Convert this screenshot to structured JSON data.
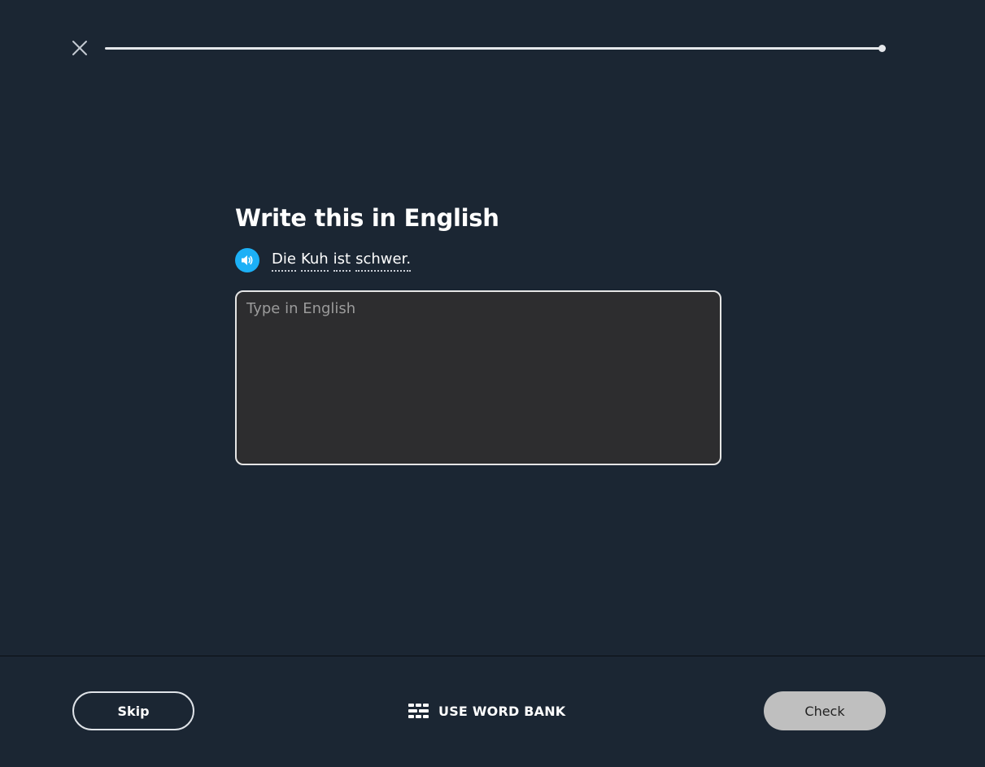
{
  "header": {
    "progress": 1.0
  },
  "challenge": {
    "title": "Write this in English",
    "prompt_words": [
      "Die",
      "Kuh",
      "ist",
      "schwer."
    ],
    "answer_placeholder": "Type in English",
    "answer_value": ""
  },
  "footer": {
    "skip_label": "Skip",
    "word_bank_label": "USE WORD BANK",
    "check_label": "Check"
  },
  "colors": {
    "background": "#1b2633",
    "speaker_accent": "#1cb0f6",
    "check_disabled": "#bfbfbf"
  },
  "icons": {
    "close": "close-icon",
    "speaker": "speaker-icon",
    "word_bank": "word-bank-icon"
  }
}
